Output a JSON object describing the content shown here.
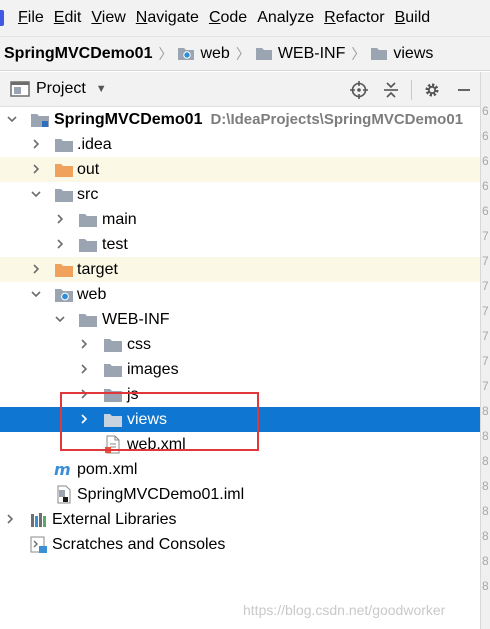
{
  "menu": {
    "items": [
      {
        "mnemonic": "F",
        "rest": "ile"
      },
      {
        "mnemonic": "E",
        "rest": "dit"
      },
      {
        "mnemonic": "V",
        "rest": "iew"
      },
      {
        "mnemonic": "N",
        "rest": "avigate"
      },
      {
        "mnemonic": "C",
        "rest": "ode"
      },
      {
        "mnemonic": "",
        "rest": "Analyze"
      },
      {
        "mnemonic": "R",
        "rest": "efactor"
      },
      {
        "mnemonic": "B",
        "rest": "uild"
      }
    ]
  },
  "breadcrumb": [
    "SpringMVCDemo01",
    "web",
    "WEB-INF",
    "views"
  ],
  "tool_window": {
    "title": "Project",
    "tools": [
      "crosshair-icon",
      "collapse-all-icon",
      "gear-icon",
      "minimize-icon"
    ]
  },
  "tree": {
    "root": {
      "label": "SpringMVCDemo01",
      "path": "D:\\IdeaProjects\\SpringMVCDemo01"
    },
    "items": [
      {
        "label": ".idea"
      },
      {
        "label": "out"
      },
      {
        "label": "src"
      },
      {
        "label": "main"
      },
      {
        "label": "test"
      },
      {
        "label": "target"
      },
      {
        "label": "web"
      },
      {
        "label": "WEB-INF"
      },
      {
        "label": "css"
      },
      {
        "label": "images"
      },
      {
        "label": "js"
      },
      {
        "label": "views"
      },
      {
        "label": "web.xml"
      },
      {
        "label": "pom.xml"
      },
      {
        "label": "SpringMVCDemo01.iml"
      },
      {
        "label": "External Libraries"
      },
      {
        "label": "Scratches and Consoles"
      }
    ]
  },
  "gutter_digits": [
    "6",
    "6",
    "6",
    "6",
    "6",
    "7",
    "7",
    "7",
    "7",
    "7",
    "7",
    "7",
    "8",
    "8",
    "8",
    "8",
    "8",
    "8",
    "8",
    "8"
  ],
  "watermark": "https://blog.csdn.net/goodworker",
  "colors": {
    "selection": "#0f77d2",
    "excluded_row": "#fbf8e6",
    "highlight_box": "#e0383a",
    "folder_gray": "#9aa5b1",
    "folder_orange": "#f0a25c"
  }
}
